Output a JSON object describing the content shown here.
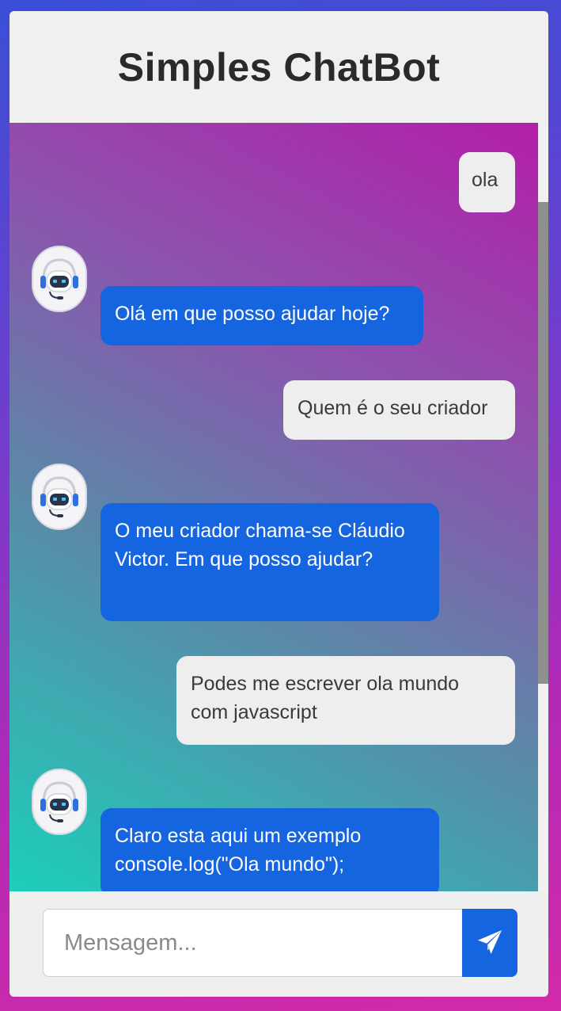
{
  "header": {
    "title": "Simples ChatBot"
  },
  "messages": [
    {
      "sender": "user",
      "text": "ola"
    },
    {
      "sender": "bot",
      "avatar_icon": "robot-icon",
      "text": "Olá em que posso ajudar hoje?"
    },
    {
      "sender": "user",
      "text": "Quem é o seu criador"
    },
    {
      "sender": "bot",
      "avatar_icon": "robot-icon",
      "text": "O meu criador chama-se Cláudio Victor. Em que posso ajudar?"
    },
    {
      "sender": "user",
      "text": "Podes me escrever ola mundo com javascript"
    },
    {
      "sender": "bot",
      "avatar_icon": "robot-icon",
      "text": "Claro esta aqui um exemplo console.log(\"Ola mundo\");"
    }
  ],
  "composer": {
    "placeholder": "Mensagem...",
    "value": "",
    "send_icon": "paper-plane-icon"
  },
  "colors": {
    "bot_bubble": "#1565e0",
    "user_bubble": "#eeeeee",
    "send_button": "#1565e0"
  }
}
